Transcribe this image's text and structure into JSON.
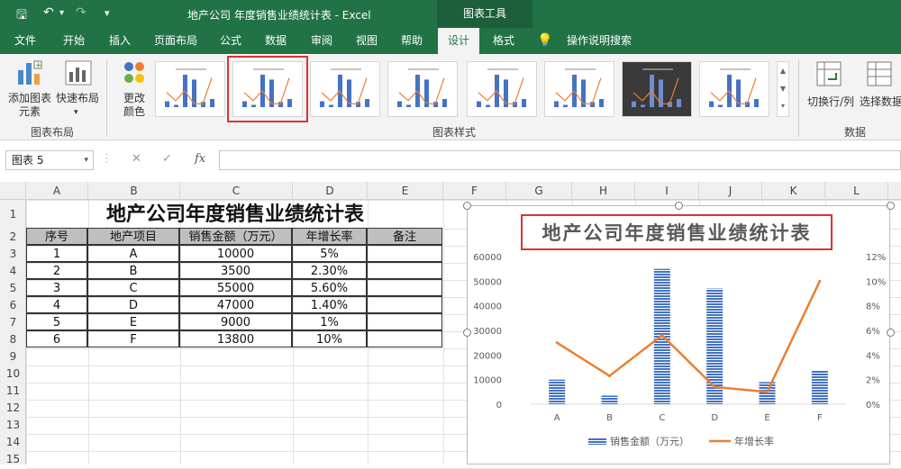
{
  "title_bar": {
    "title": "地产公司 年度销售业绩统计表  -  Excel",
    "context": "图表工具"
  },
  "tabs": [
    "文件",
    "开始",
    "插入",
    "页面布局",
    "公式",
    "数据",
    "审阅",
    "视图",
    "帮助",
    "设计",
    "格式",
    "操作说明搜索"
  ],
  "ribbon": {
    "add_element": "添加图表\n元素",
    "quick_layout": "快速布局",
    "change_color": "更改\n颜色",
    "group_layout": "图表布局",
    "group_styles": "图表样式",
    "switch_rowcol": "切换行/列",
    "select_data": "选择数据",
    "group_data": "数据"
  },
  "name_box": "图表 5",
  "fx": "fx",
  "columns": [
    "A",
    "B",
    "C",
    "D",
    "E",
    "F",
    "G",
    "H",
    "I",
    "J",
    "K",
    "L"
  ],
  "rows": [
    "1",
    "2",
    "3",
    "4",
    "5",
    "6",
    "7",
    "8",
    "9",
    "10",
    "11",
    "12",
    "13",
    "14",
    "15"
  ],
  "table": {
    "title": "地产公司年度销售业绩统计表",
    "headers": [
      "序号",
      "地产项目",
      "销售金额（万元）",
      "年增长率",
      "备注"
    ],
    "rows": [
      [
        "1",
        "A",
        "10000",
        "5%",
        ""
      ],
      [
        "2",
        "B",
        "3500",
        "2.30%",
        ""
      ],
      [
        "3",
        "C",
        "55000",
        "5.60%",
        ""
      ],
      [
        "4",
        "D",
        "47000",
        "1.40%",
        ""
      ],
      [
        "5",
        "E",
        "9000",
        "1%",
        ""
      ],
      [
        "6",
        "F",
        "13800",
        "10%",
        ""
      ]
    ]
  },
  "chart_data": {
    "type": "bar",
    "title": "地产公司年度销售业绩统计表",
    "categories": [
      "A",
      "B",
      "C",
      "D",
      "E",
      "F"
    ],
    "series": [
      {
        "name": "销售金额（万元）",
        "type": "bar",
        "axis": "left",
        "values": [
          10000,
          3500,
          55000,
          47000,
          9000,
          13800
        ],
        "color": "#4472c4"
      },
      {
        "name": "年增长率",
        "type": "line",
        "axis": "right",
        "values": [
          5,
          2.3,
          5.6,
          1.4,
          1,
          10
        ],
        "color": "#ed7d31"
      }
    ],
    "y_left": {
      "ticks": [
        "0",
        "10000",
        "20000",
        "30000",
        "40000",
        "50000",
        "60000"
      ],
      "range": [
        0,
        60000
      ]
    },
    "y_right": {
      "ticks": [
        "0%",
        "2%",
        "4%",
        "6%",
        "8%",
        "10%",
        "12%"
      ],
      "range": [
        0,
        12
      ]
    },
    "legend": "bottom",
    "grid": false
  },
  "colors": {
    "accent": "#217346",
    "highlight": "#e03030"
  }
}
